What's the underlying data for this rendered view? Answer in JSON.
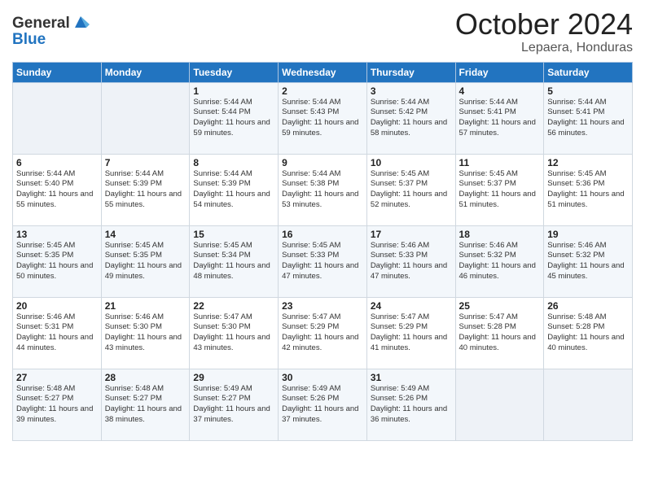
{
  "header": {
    "logo_line1": "General",
    "logo_line2": "Blue",
    "month": "October 2024",
    "location": "Lepaera, Honduras"
  },
  "weekdays": [
    "Sunday",
    "Monday",
    "Tuesday",
    "Wednesday",
    "Thursday",
    "Friday",
    "Saturday"
  ],
  "weeks": [
    [
      {
        "day": "",
        "sunrise": "",
        "sunset": "",
        "daylight": "",
        "empty": true
      },
      {
        "day": "",
        "sunrise": "",
        "sunset": "",
        "daylight": "",
        "empty": true
      },
      {
        "day": "1",
        "sunrise": "Sunrise: 5:44 AM",
        "sunset": "Sunset: 5:44 PM",
        "daylight": "Daylight: 11 hours and 59 minutes."
      },
      {
        "day": "2",
        "sunrise": "Sunrise: 5:44 AM",
        "sunset": "Sunset: 5:43 PM",
        "daylight": "Daylight: 11 hours and 59 minutes."
      },
      {
        "day": "3",
        "sunrise": "Sunrise: 5:44 AM",
        "sunset": "Sunset: 5:42 PM",
        "daylight": "Daylight: 11 hours and 58 minutes."
      },
      {
        "day": "4",
        "sunrise": "Sunrise: 5:44 AM",
        "sunset": "Sunset: 5:41 PM",
        "daylight": "Daylight: 11 hours and 57 minutes."
      },
      {
        "day": "5",
        "sunrise": "Sunrise: 5:44 AM",
        "sunset": "Sunset: 5:41 PM",
        "daylight": "Daylight: 11 hours and 56 minutes."
      }
    ],
    [
      {
        "day": "6",
        "sunrise": "Sunrise: 5:44 AM",
        "sunset": "Sunset: 5:40 PM",
        "daylight": "Daylight: 11 hours and 55 minutes."
      },
      {
        "day": "7",
        "sunrise": "Sunrise: 5:44 AM",
        "sunset": "Sunset: 5:39 PM",
        "daylight": "Daylight: 11 hours and 55 minutes."
      },
      {
        "day": "8",
        "sunrise": "Sunrise: 5:44 AM",
        "sunset": "Sunset: 5:39 PM",
        "daylight": "Daylight: 11 hours and 54 minutes."
      },
      {
        "day": "9",
        "sunrise": "Sunrise: 5:44 AM",
        "sunset": "Sunset: 5:38 PM",
        "daylight": "Daylight: 11 hours and 53 minutes."
      },
      {
        "day": "10",
        "sunrise": "Sunrise: 5:45 AM",
        "sunset": "Sunset: 5:37 PM",
        "daylight": "Daylight: 11 hours and 52 minutes."
      },
      {
        "day": "11",
        "sunrise": "Sunrise: 5:45 AM",
        "sunset": "Sunset: 5:37 PM",
        "daylight": "Daylight: 11 hours and 51 minutes."
      },
      {
        "day": "12",
        "sunrise": "Sunrise: 5:45 AM",
        "sunset": "Sunset: 5:36 PM",
        "daylight": "Daylight: 11 hours and 51 minutes."
      }
    ],
    [
      {
        "day": "13",
        "sunrise": "Sunrise: 5:45 AM",
        "sunset": "Sunset: 5:35 PM",
        "daylight": "Daylight: 11 hours and 50 minutes."
      },
      {
        "day": "14",
        "sunrise": "Sunrise: 5:45 AM",
        "sunset": "Sunset: 5:35 PM",
        "daylight": "Daylight: 11 hours and 49 minutes."
      },
      {
        "day": "15",
        "sunrise": "Sunrise: 5:45 AM",
        "sunset": "Sunset: 5:34 PM",
        "daylight": "Daylight: 11 hours and 48 minutes."
      },
      {
        "day": "16",
        "sunrise": "Sunrise: 5:45 AM",
        "sunset": "Sunset: 5:33 PM",
        "daylight": "Daylight: 11 hours and 47 minutes."
      },
      {
        "day": "17",
        "sunrise": "Sunrise: 5:46 AM",
        "sunset": "Sunset: 5:33 PM",
        "daylight": "Daylight: 11 hours and 47 minutes."
      },
      {
        "day": "18",
        "sunrise": "Sunrise: 5:46 AM",
        "sunset": "Sunset: 5:32 PM",
        "daylight": "Daylight: 11 hours and 46 minutes."
      },
      {
        "day": "19",
        "sunrise": "Sunrise: 5:46 AM",
        "sunset": "Sunset: 5:32 PM",
        "daylight": "Daylight: 11 hours and 45 minutes."
      }
    ],
    [
      {
        "day": "20",
        "sunrise": "Sunrise: 5:46 AM",
        "sunset": "Sunset: 5:31 PM",
        "daylight": "Daylight: 11 hours and 44 minutes."
      },
      {
        "day": "21",
        "sunrise": "Sunrise: 5:46 AM",
        "sunset": "Sunset: 5:30 PM",
        "daylight": "Daylight: 11 hours and 43 minutes."
      },
      {
        "day": "22",
        "sunrise": "Sunrise: 5:47 AM",
        "sunset": "Sunset: 5:30 PM",
        "daylight": "Daylight: 11 hours and 43 minutes."
      },
      {
        "day": "23",
        "sunrise": "Sunrise: 5:47 AM",
        "sunset": "Sunset: 5:29 PM",
        "daylight": "Daylight: 11 hours and 42 minutes."
      },
      {
        "day": "24",
        "sunrise": "Sunrise: 5:47 AM",
        "sunset": "Sunset: 5:29 PM",
        "daylight": "Daylight: 11 hours and 41 minutes."
      },
      {
        "day": "25",
        "sunrise": "Sunrise: 5:47 AM",
        "sunset": "Sunset: 5:28 PM",
        "daylight": "Daylight: 11 hours and 40 minutes."
      },
      {
        "day": "26",
        "sunrise": "Sunrise: 5:48 AM",
        "sunset": "Sunset: 5:28 PM",
        "daylight": "Daylight: 11 hours and 40 minutes."
      }
    ],
    [
      {
        "day": "27",
        "sunrise": "Sunrise: 5:48 AM",
        "sunset": "Sunset: 5:27 PM",
        "daylight": "Daylight: 11 hours and 39 minutes."
      },
      {
        "day": "28",
        "sunrise": "Sunrise: 5:48 AM",
        "sunset": "Sunset: 5:27 PM",
        "daylight": "Daylight: 11 hours and 38 minutes."
      },
      {
        "day": "29",
        "sunrise": "Sunrise: 5:49 AM",
        "sunset": "Sunset: 5:27 PM",
        "daylight": "Daylight: 11 hours and 37 minutes."
      },
      {
        "day": "30",
        "sunrise": "Sunrise: 5:49 AM",
        "sunset": "Sunset: 5:26 PM",
        "daylight": "Daylight: 11 hours and 37 minutes."
      },
      {
        "day": "31",
        "sunrise": "Sunrise: 5:49 AM",
        "sunset": "Sunset: 5:26 PM",
        "daylight": "Daylight: 11 hours and 36 minutes."
      },
      {
        "day": "",
        "sunrise": "",
        "sunset": "",
        "daylight": "",
        "empty": true
      },
      {
        "day": "",
        "sunrise": "",
        "sunset": "",
        "daylight": "",
        "empty": true
      }
    ]
  ]
}
